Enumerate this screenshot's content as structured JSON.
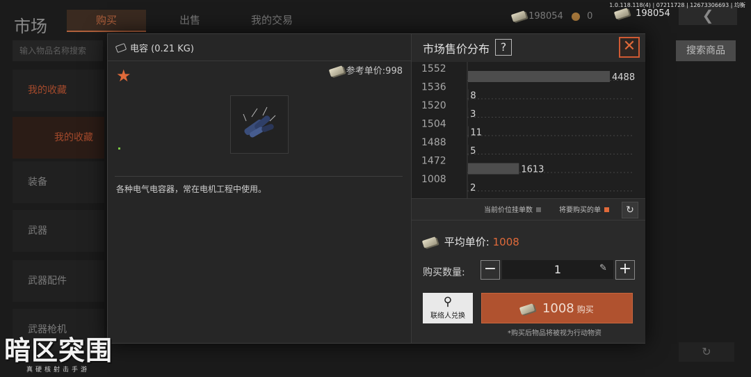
{
  "version": "1.0.118.118(4) | 07211728 | 12673306693 | 均衡",
  "top_bar": {
    "cash_a": "198054",
    "coin": "0",
    "cash_b": "198054"
  },
  "market": {
    "title": "市场",
    "tabs": [
      "购买",
      "出售",
      "我的交易"
    ],
    "search_placeholder": "输入物品名称搜索",
    "search_button": "搜索商品",
    "sidebar": [
      "我的收藏",
      "我的收藏",
      "装备",
      "武器",
      "武器配件",
      "武器枪机"
    ]
  },
  "item": {
    "name": "电容 (0.21 KG)",
    "ref_price_label": "参考单价:",
    "ref_price": "998",
    "description": "各种电气电容器，常在电机工程中使用。"
  },
  "distribution": {
    "title": "市场售价分布",
    "help": "?",
    "legend_current": "当前价位挂单数",
    "legend_buy": "将要购买的单"
  },
  "chart_data": {
    "type": "bar",
    "orientation": "horizontal",
    "categories": [
      "1552",
      "1536",
      "1520",
      "1504",
      "1488",
      "1472",
      "1008"
    ],
    "values": [
      4488,
      8,
      3,
      11,
      5,
      1613,
      2
    ],
    "title": "市场售价分布",
    "xlim": [
      0,
      4488
    ]
  },
  "purchase": {
    "avg_label": "平均单价:",
    "avg_value": "1008",
    "qty_label": "购买数量:",
    "qty_value": "1",
    "minus": "−",
    "plus": "+",
    "contact_label": "联络人兑换",
    "buy_amount": "1008",
    "buy_label": "购买",
    "note": "*购买后物品将被视为行动物资"
  },
  "logo": {
    "title": "暗区突围",
    "subtitle": "真硬核射击手游"
  },
  "colors": {
    "accent": "#e06a3a",
    "buy_button": "#b0522f",
    "bar": "#4d4d4d"
  }
}
